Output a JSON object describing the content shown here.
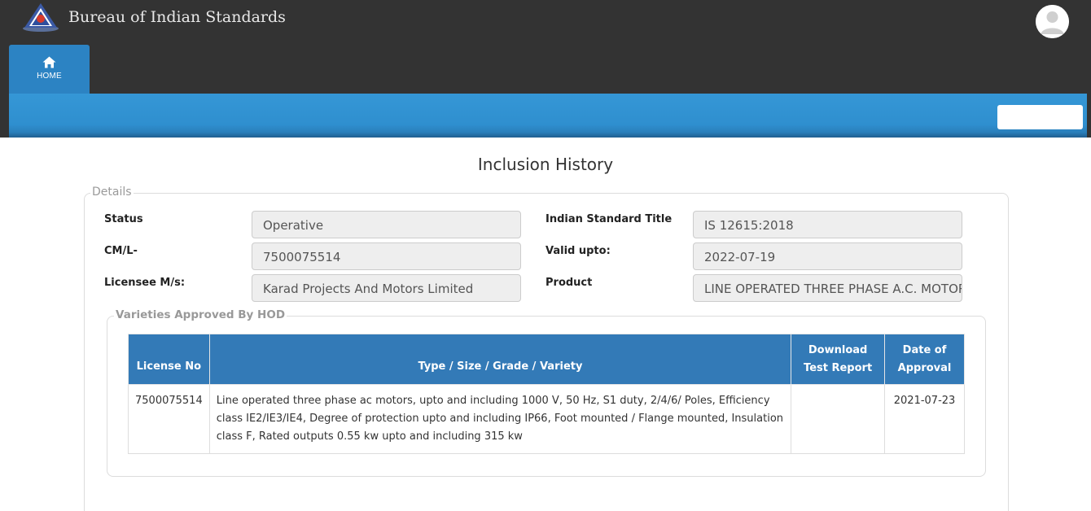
{
  "header": {
    "site_title": "Bureau of Indian Standards",
    "home_tab_label": "HOME",
    "home_icon": "home-icon",
    "logo_icon": "bis-logo-icon",
    "avatar_icon": "user-avatar-icon"
  },
  "page": {
    "title": "Inclusion History"
  },
  "details": {
    "legend": "Details",
    "fields": {
      "status_label": "Status",
      "status_value": "Operative",
      "cml_label": "CM/L-",
      "cml_value": "7500075514",
      "licensee_label": "Licensee M/s:",
      "licensee_value": "Karad Projects And Motors Limited",
      "standard_label": "Indian Standard Title",
      "standard_value": "IS 12615:2018",
      "valid_label": "Valid upto:",
      "valid_value": "2022-07-19",
      "product_label": "Product",
      "product_value": "LINE OPERATED THREE PHASE A.C. MOTORS"
    }
  },
  "varieties": {
    "legend": "Varieties Approved By HOD",
    "columns": {
      "license_no": "License No",
      "type": "Type / Size / Grade / Variety",
      "download_line1": "Download",
      "download_line2": "Test Report",
      "date_line1": "Date of",
      "date_line2": "Approval"
    },
    "rows": [
      {
        "license_no": "7500075514",
        "type": "Line operated three phase ac motors, upto and including 1000 V, 50 Hz, S1 duty, 2/4/6/ Poles, Efficiency class IE2/IE3/IE4, Degree of protection upto and including IP66, Foot mounted / Flange mounted, Insulation class F, Rated outputs 0.55 kw upto and including 315 kw",
        "download": "",
        "date": "2021-07-23"
      }
    ]
  },
  "colors": {
    "header_bg": "#333333",
    "nav_blue": "#3597d6",
    "table_header": "#337ab7"
  }
}
